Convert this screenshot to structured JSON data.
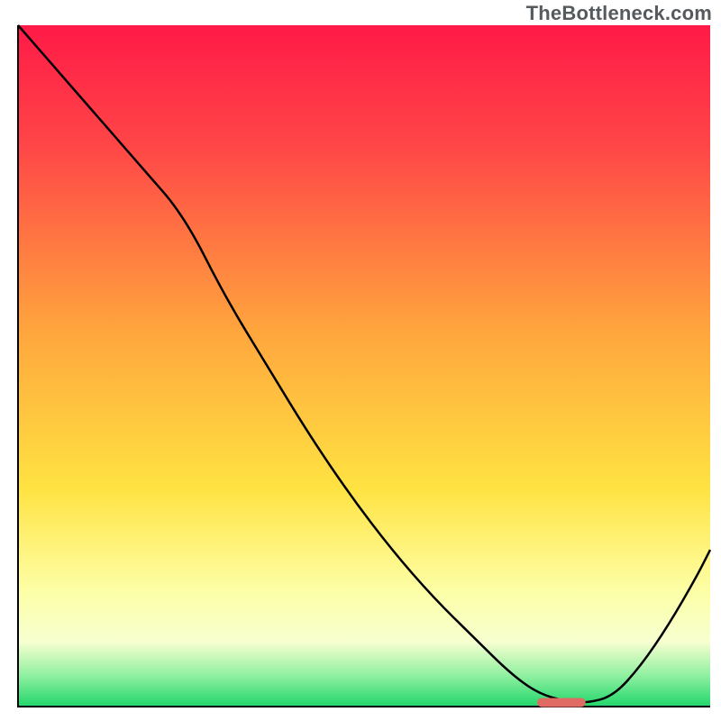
{
  "watermark": "TheBottleneck.com",
  "colors": {
    "gradient_top": "#ff1a47",
    "gradient_mid_red": "#ff4747",
    "gradient_orange": "#ffa63d",
    "gradient_yellow": "#ffe342",
    "gradient_pale": "#fdffa6",
    "gradient_cream": "#f7ffd0",
    "gradient_green_light": "#8ef0a0",
    "gradient_green": "#22d66b",
    "curve_stroke": "#000000",
    "marker_fill": "#e06a64",
    "axis_stroke": "#000000"
  },
  "chart_data": {
    "type": "line",
    "title": "",
    "xlabel": "",
    "ylabel": "",
    "xlim": [
      0,
      100
    ],
    "ylim": [
      0,
      100
    ],
    "note": "Axes are unlabeled in the source image; values are pixel-derived estimates on a 0–100 normalized scale.",
    "series": [
      {
        "name": "bottleneck-curve",
        "x": [
          0,
          6,
          12,
          18,
          24,
          30,
          36,
          42,
          48,
          54,
          60,
          66,
          71,
          75,
          79,
          82,
          86,
          90,
          94,
          98,
          100
        ],
        "y": [
          100,
          93,
          86,
          79,
          72,
          60,
          50,
          40,
          31,
          23,
          16,
          10,
          5,
          2,
          0.8,
          0.5,
          1.5,
          6,
          12,
          19,
          23
        ]
      }
    ],
    "optimal_marker": {
      "x_start": 75,
      "x_end": 82,
      "y": 0.6
    },
    "gradient_stops": [
      {
        "offset": 0.0,
        "color": "#ff1a47"
      },
      {
        "offset": 0.18,
        "color": "#ff4747"
      },
      {
        "offset": 0.45,
        "color": "#ffa63d"
      },
      {
        "offset": 0.68,
        "color": "#ffe342"
      },
      {
        "offset": 0.83,
        "color": "#fdffa6"
      },
      {
        "offset": 0.905,
        "color": "#f7ffd0"
      },
      {
        "offset": 0.955,
        "color": "#8ef0a0"
      },
      {
        "offset": 1.0,
        "color": "#22d66b"
      }
    ]
  }
}
